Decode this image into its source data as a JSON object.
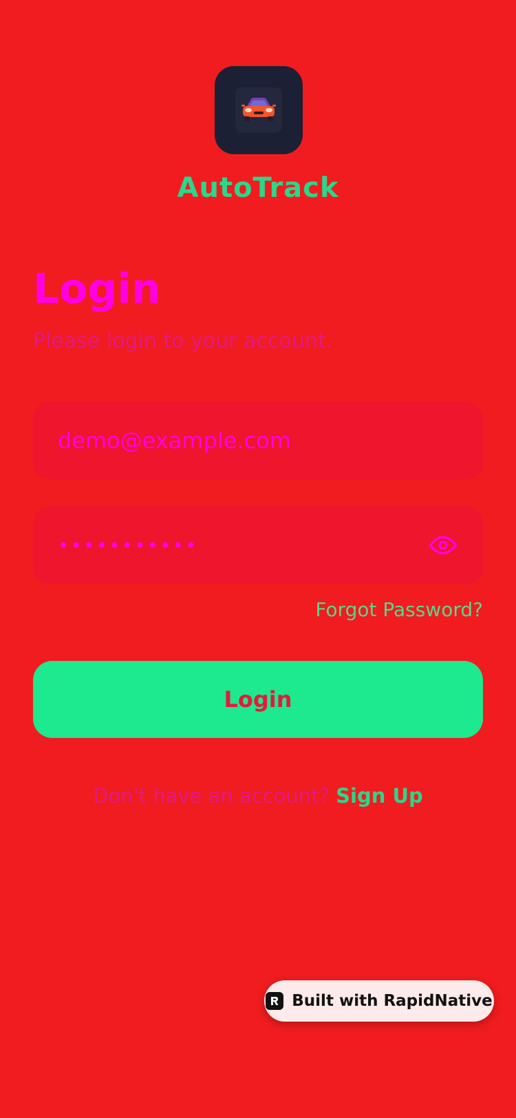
{
  "brand": {
    "name": "AutoTrack",
    "logo_icon": "car-icon"
  },
  "login": {
    "title": "Login",
    "subtitle": "Please login to your account.",
    "email": {
      "value": "demo@example.com"
    },
    "password": {
      "value": "•••••••••••",
      "toggle_icon": "eye-icon"
    },
    "forgot_label": "Forgot Password?",
    "submit_label": "Login",
    "signup_prompt": "Don't have an account? ",
    "signup_label": "Sign Up"
  },
  "badge": {
    "label": "Built with RapidNative",
    "icon": "rapidnative-logo-icon"
  },
  "colors": {
    "background": "#f01c1f",
    "brand_green": "#2cd68b",
    "title_magenta": "#ff00e5",
    "button_green": "#1de98e",
    "logo_tile": "#1c2035"
  }
}
